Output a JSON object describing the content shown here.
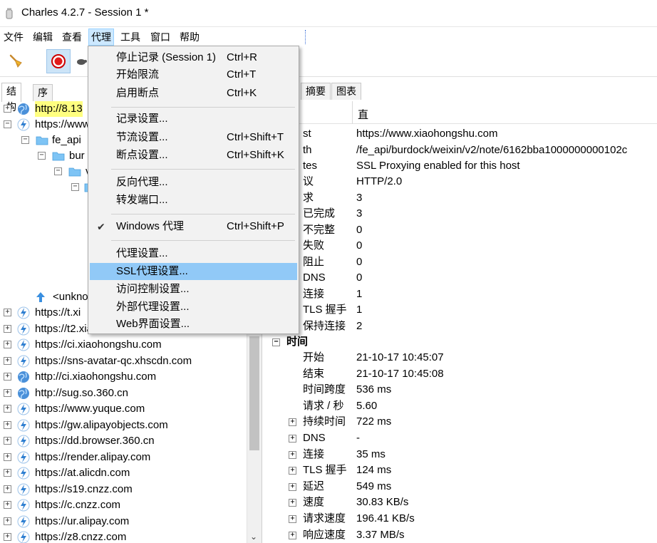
{
  "window": {
    "title": "Charles 4.2.7 - Session 1 *"
  },
  "menubar": [
    "文件",
    "编辑",
    "查看",
    "代理",
    "工具",
    "窗口",
    "帮助"
  ],
  "left_tabs": [
    "结构",
    "序列"
  ],
  "tree": [
    {
      "label": "http://8.13",
      "icon": "globe-icon",
      "highlight": true
    },
    {
      "label": "https://www",
      "icon": "lightning-globe-icon"
    },
    {
      "label": "fe_api",
      "icon": "folder-icon"
    },
    {
      "label": "bur",
      "icon": "folder-icon"
    },
    {
      "label": "v",
      "icon": "folder-icon"
    },
    {
      "label": "",
      "icon": "folder-icon"
    },
    {
      "label": "<unkno",
      "icon": "up-arrow-icon"
    },
    {
      "label": "https://t.xi",
      "icon": "lightning-globe-icon"
    },
    {
      "label": "https://t2.xiaohongshu.com",
      "icon": "lightning-globe-icon"
    },
    {
      "label": "https://ci.xiaohongshu.com",
      "icon": "lightning-globe-icon"
    },
    {
      "label": "https://sns-avatar-qc.xhscdn.com",
      "icon": "lightning-globe-icon"
    },
    {
      "label": "http://ci.xiaohongshu.com",
      "icon": "globe-icon"
    },
    {
      "label": "http://sug.so.360.cn",
      "icon": "globe-icon"
    },
    {
      "label": "https://www.yuque.com",
      "icon": "lightning-globe-icon"
    },
    {
      "label": "https://gw.alipayobjects.com",
      "icon": "lightning-globe-icon"
    },
    {
      "label": "https://dd.browser.360.cn",
      "icon": "lightning-globe-icon"
    },
    {
      "label": "https://render.alipay.com",
      "icon": "lightning-globe-icon"
    },
    {
      "label": "https://at.alicdn.com",
      "icon": "lightning-globe-icon"
    },
    {
      "label": "https://s19.cnzz.com",
      "icon": "lightning-globe-icon"
    },
    {
      "label": "https://c.cnzz.com",
      "icon": "lightning-globe-icon"
    },
    {
      "label": "https://ur.alipay.com",
      "icon": "lightning-globe-icon"
    },
    {
      "label": "https://z8.cnzz.com",
      "icon": "lightning-globe-icon"
    }
  ],
  "right_tabs": [
    "摘要",
    "图表"
  ],
  "right_header": {
    "value_col": "直"
  },
  "details": [
    {
      "key": "st",
      "value": "https://www.xiaohongshu.com"
    },
    {
      "key": "th",
      "value": "/fe_api/burdock/weixin/v2/note/6162bba1000000000102c"
    },
    {
      "key": "tes",
      "value": "SSL Proxying enabled for this host"
    },
    {
      "key": "议",
      "value": "HTTP/2.0"
    },
    {
      "key": "求",
      "value": "3"
    },
    {
      "key": "已完成",
      "value": "3"
    },
    {
      "key": "不完整",
      "value": "0"
    },
    {
      "key": "失败",
      "value": "0"
    },
    {
      "key": "阻止",
      "value": "0"
    },
    {
      "key": "DNS",
      "value": "0"
    },
    {
      "key": "连接",
      "value": "1"
    },
    {
      "key": "TLS 握手",
      "value": "1"
    },
    {
      "key": "保持连接",
      "value": "2"
    }
  ],
  "time_section": {
    "label": "时间"
  },
  "time_rows": [
    {
      "key": "开始",
      "value": "21-10-17 10:45:07",
      "expandable": false
    },
    {
      "key": "结束",
      "value": "21-10-17 10:45:08",
      "expandable": false
    },
    {
      "key": "时间跨度",
      "value": "536 ms",
      "expandable": false
    },
    {
      "key": "请求 / 秒",
      "value": "5.60",
      "expandable": false
    },
    {
      "key": "持续时间",
      "value": "722 ms",
      "expandable": true
    },
    {
      "key": "DNS",
      "value": "-",
      "expandable": true
    },
    {
      "key": "连接",
      "value": "35 ms",
      "expandable": true
    },
    {
      "key": "TLS 握手",
      "value": "124 ms",
      "expandable": true
    },
    {
      "key": "延迟",
      "value": "549 ms",
      "expandable": true
    },
    {
      "key": "速度",
      "value": "30.83 KB/s",
      "expandable": true
    },
    {
      "key": "请求速度",
      "value": "196.41 KB/s",
      "expandable": true
    },
    {
      "key": "响应速度",
      "value": "3.37 MB/s",
      "expandable": true
    }
  ],
  "proxy_menu": {
    "items": [
      {
        "label": "停止记录 (Session 1)",
        "shortcut": "Ctrl+R"
      },
      {
        "label": "开始限流",
        "shortcut": "Ctrl+T"
      },
      {
        "label": "启用断点",
        "shortcut": "Ctrl+K"
      },
      {
        "label": "记录设置...",
        "shortcut": ""
      },
      {
        "label": "节流设置...",
        "shortcut": "Ctrl+Shift+T"
      },
      {
        "label": "断点设置...",
        "shortcut": "Ctrl+Shift+K"
      },
      {
        "label": "反向代理...",
        "shortcut": ""
      },
      {
        "label": "转发端口...",
        "shortcut": ""
      },
      {
        "label": "Windows 代理",
        "shortcut": "Ctrl+Shift+P",
        "checked": true
      },
      {
        "label": "代理设置...",
        "shortcut": ""
      },
      {
        "label": "SSL代理设置...",
        "shortcut": "",
        "hover": true
      },
      {
        "label": "访问控制设置...",
        "shortcut": ""
      },
      {
        "label": "外部代理设置...",
        "shortcut": ""
      },
      {
        "label": "Web界面设置...",
        "shortcut": ""
      }
    ],
    "check_mark": "✔"
  },
  "colors": {
    "highlight": "#ffff80",
    "menu_hover": "#91c9f7",
    "menubar_active": "#cce8ff"
  }
}
